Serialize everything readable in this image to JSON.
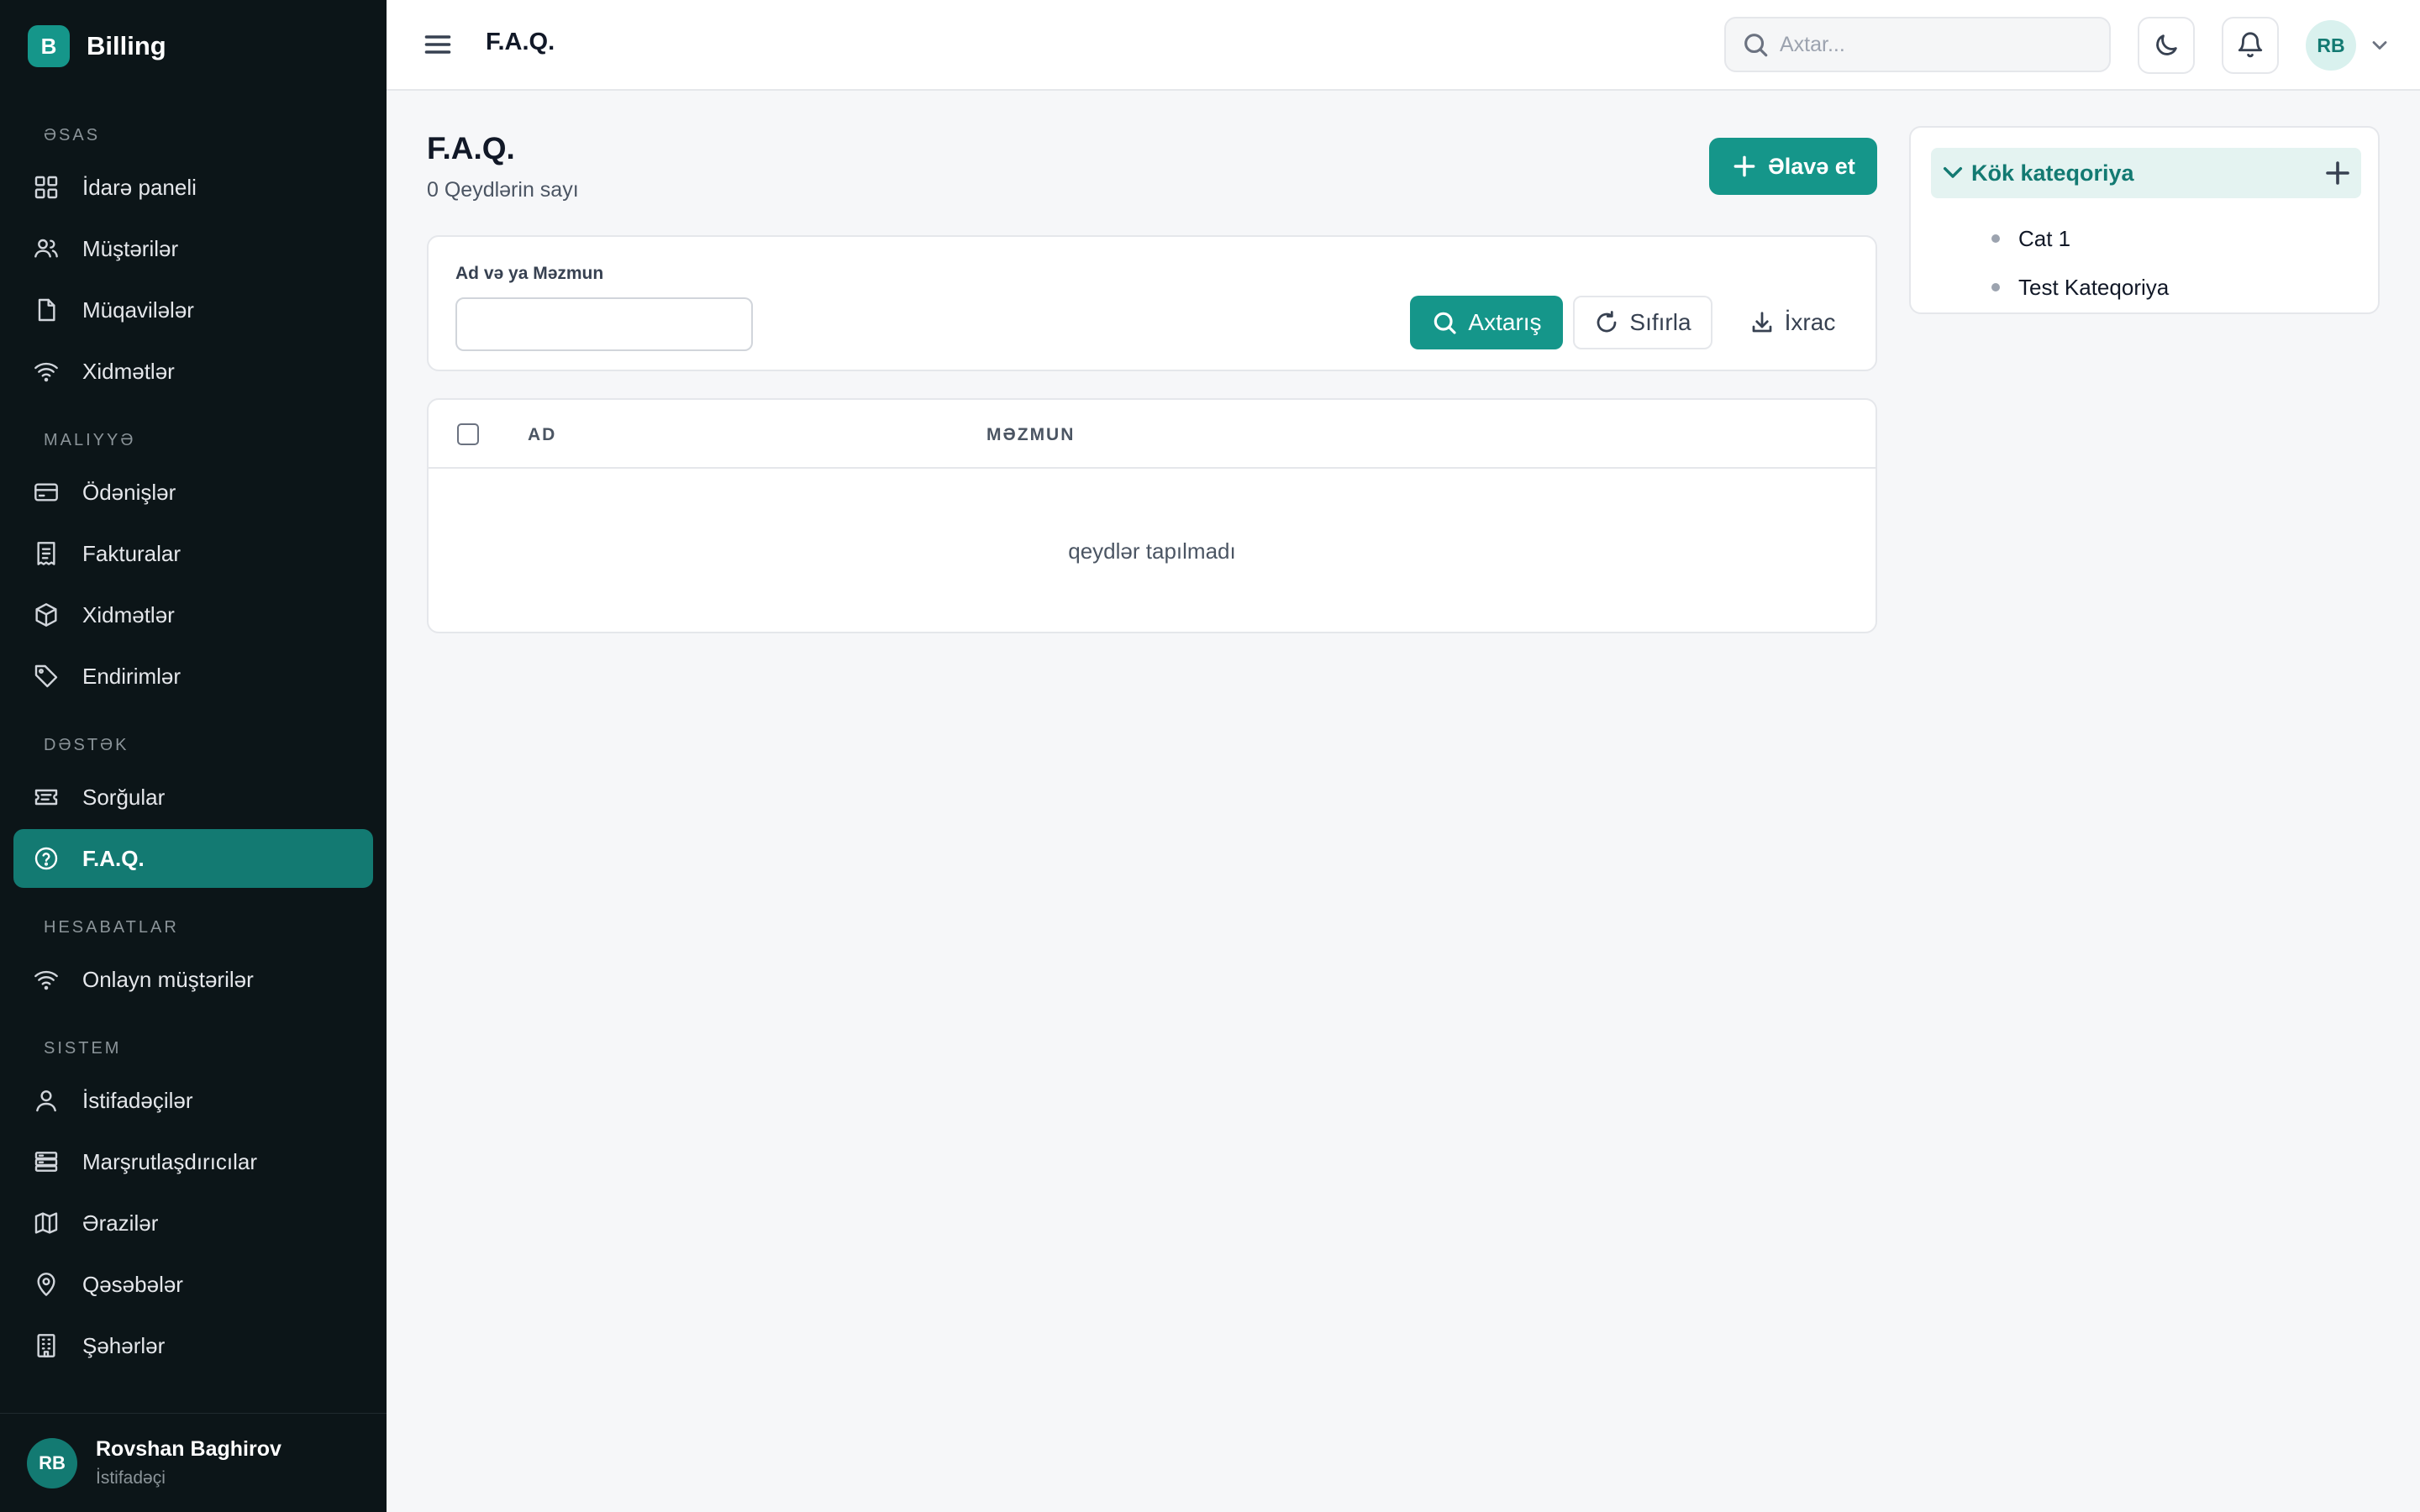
{
  "brand": {
    "logo_letter": "B",
    "name": "Billing"
  },
  "sidebar": {
    "sections": [
      {
        "title": "Əsas",
        "items": [
          {
            "label": "İdarə paneli",
            "icon": "dashboard-icon",
            "active": false
          },
          {
            "label": "Müştərilər",
            "icon": "users-icon",
            "active": false
          },
          {
            "label": "Müqavilələr",
            "icon": "document-icon",
            "active": false
          },
          {
            "label": "Xidmətlər",
            "icon": "wifi-icon",
            "active": false
          }
        ]
      },
      {
        "title": "Maliyyə",
        "items": [
          {
            "label": "Ödənişlər",
            "icon": "credit-card-icon",
            "active": false
          },
          {
            "label": "Fakturalar",
            "icon": "receipt-icon",
            "active": false
          },
          {
            "label": "Xidmətlər",
            "icon": "box-icon",
            "active": false
          },
          {
            "label": "Endirimlər",
            "icon": "tag-icon",
            "active": false
          }
        ]
      },
      {
        "title": "Dəstək",
        "items": [
          {
            "label": "Sorğular",
            "icon": "ticket-icon",
            "active": false
          },
          {
            "label": "F.A.Q.",
            "icon": "help-circle-icon",
            "active": true
          }
        ]
      },
      {
        "title": "Hesabatlar",
        "items": [
          {
            "label": "Onlayn müştərilər",
            "icon": "wifi-icon",
            "active": false
          }
        ]
      },
      {
        "title": "Sistem",
        "items": [
          {
            "label": "İstifadəçilər",
            "icon": "user-icon",
            "active": false
          },
          {
            "label": "Marşrutlaşdırıcılar",
            "icon": "router-icon",
            "active": false
          },
          {
            "label": "Ərazilər",
            "icon": "map-icon",
            "active": false
          },
          {
            "label": "Qəsəbələr",
            "icon": "map-pin-icon",
            "active": false
          },
          {
            "label": "Şəhərlər",
            "icon": "building-icon",
            "active": false
          }
        ]
      }
    ]
  },
  "footer_user": {
    "initials": "RB",
    "name": "Rovshan Baghirov",
    "role": "İstifadəçi"
  },
  "header": {
    "title": "F.A.Q.",
    "search_placeholder": "Axtar...",
    "avatar_initials": "RB"
  },
  "page": {
    "title": "F.A.Q.",
    "count_text": "0 Qeydlərin sayı",
    "add_label": "Əlavə et"
  },
  "filter": {
    "label": "Ad və ya Məzmun",
    "value": "",
    "search_label": "Axtarış",
    "reset_label": "Sıfırla",
    "export_label": "İxrac"
  },
  "table": {
    "columns": [
      "Ad",
      "Məzmun"
    ],
    "empty_text": "qeydlər tapılmadı"
  },
  "categories": {
    "root": "Kök kateqoriya",
    "children": [
      "Cat 1",
      "Test Kateqoriya"
    ]
  },
  "colors": {
    "accent": "#15968a",
    "sidebar_bg": "#0c1518",
    "active_item": "#137a72"
  }
}
